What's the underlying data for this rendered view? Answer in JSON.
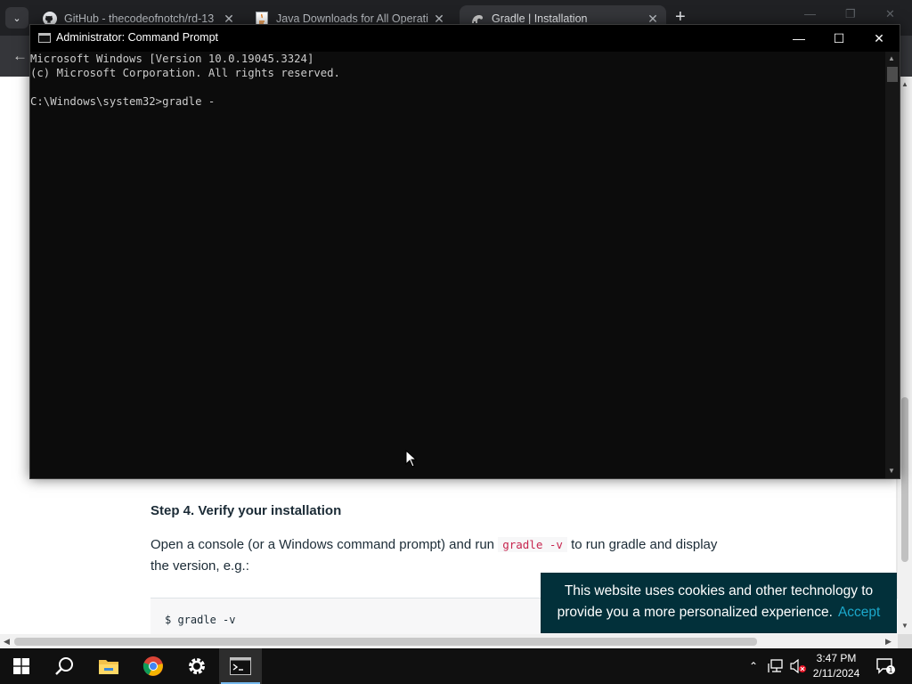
{
  "browser": {
    "tabs": [
      {
        "title": "GitHub - thecodeofnotch/rd-13",
        "icon": "github-icon"
      },
      {
        "title": "Java Downloads for All Operati",
        "icon": "java-icon"
      },
      {
        "title": "Gradle | Installation",
        "icon": "gradle-icon",
        "active": true
      }
    ],
    "new_tab": "+",
    "close_glyph": "✕",
    "back_glyph": "←"
  },
  "page": {
    "step_heading": "Step 4. Verify your installation",
    "para_before": "Open a console (or a Windows command prompt) and run ",
    "para_code": "gradle -v",
    "para_after": " to run gradle and display the version, e.g.:",
    "codeblock": "$ gradle -v",
    "cookie_text": "This website uses cookies and other technology to provide you a more personalized experience.",
    "cookie_accept": "Accept"
  },
  "cmd": {
    "title": "Administrator: Command Prompt",
    "lines": [
      "Microsoft Windows [Version 10.0.19045.3324]",
      "(c) Microsoft Corporation. All rights reserved.",
      "",
      "C:\\Windows\\system32>gradle -"
    ]
  },
  "taskbar": {
    "apps": [
      "windows-start-icon",
      "search-icon",
      "file-explorer-icon",
      "chrome-icon",
      "settings-gear-icon",
      "command-prompt-icon"
    ],
    "time": "3:47 PM",
    "date": "2/11/2024",
    "notifications": "1"
  },
  "colors": {
    "cookie_bg": "#02303a",
    "cookie_accept": "#1ba8cb",
    "inline_code": "#c7254e",
    "taskbar_active": "#76b9ed"
  }
}
